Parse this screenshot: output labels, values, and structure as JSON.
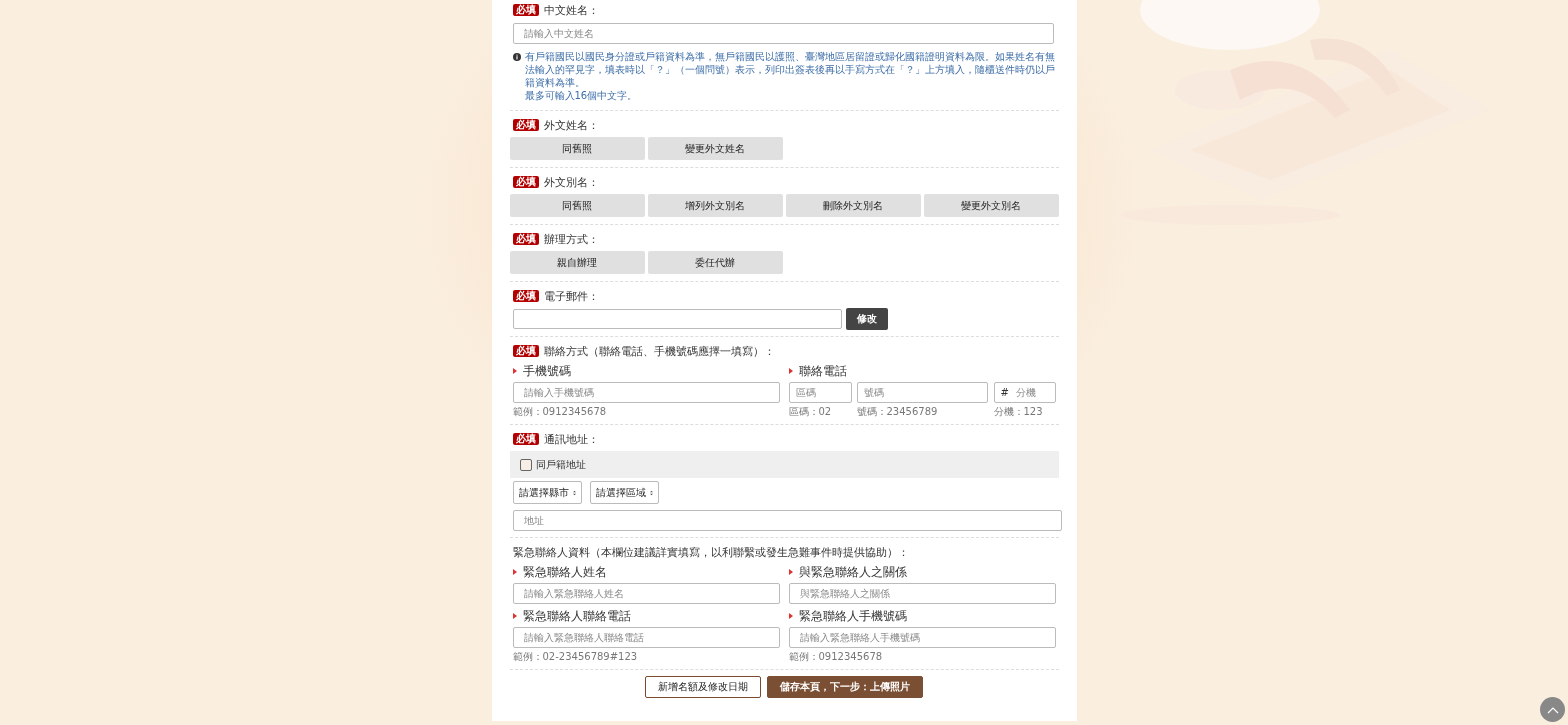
{
  "sections": [
    {
      "kind": "text",
      "badge": "必填",
      "label": "中文姓名：",
      "placeholder": "請輸入中文姓名",
      "notes": [
        "有戶籍國民以國民身分證或戶籍資料為準，無戶籍國民以護照、臺灣地區居留證或歸化國籍證明資料為限。如果姓名有無法輸入的罕見字，填表時以「？」（一個問號）表示，列印出簽表後再以手寫方式在「？」上方填入，隨櫃送件時仍以戶籍資料為準。",
        "最多可輸入16個中文字。"
      ]
    },
    {
      "kind": "buttons",
      "badge": "必填",
      "label": "外文姓名：",
      "buttons": [
        "同舊照",
        "變更外文姓名"
      ]
    },
    {
      "kind": "buttons",
      "badge": "必填",
      "label": "外文別名：",
      "buttons": [
        "同舊照",
        "增列外文別名",
        "刪除外文別名",
        "變更外文別名"
      ]
    },
    {
      "kind": "buttons",
      "badge": "必填",
      "label": "辦理方式：",
      "buttons": [
        "親自辦理",
        "委任代辦"
      ]
    },
    {
      "kind": "email",
      "badge": "必填",
      "label": "電子郵件：",
      "button": "修改"
    },
    {
      "kind": "contact",
      "badge": "必填",
      "label": "聯絡方式（聯絡電話、手機號碼應擇一填寫）：",
      "mobile": {
        "title": "手機號碼",
        "placeholder": "請輸入手機號碼",
        "hint": "範例：0912345678"
      },
      "phone": {
        "title": "聯絡電話",
        "fields": [
          {
            "placeholder": "區碼",
            "hint": "區碼：02"
          },
          {
            "placeholder": "號碼",
            "hint": "號碼：23456789"
          },
          {
            "prefix": "#",
            "placeholder": "分機",
            "hint": "分機：123"
          }
        ]
      }
    },
    {
      "kind": "address",
      "badge": "必填",
      "label": "通訊地址：",
      "checkbox": {
        "label": "同戶籍地址",
        "checked": false
      },
      "selects": [
        "請選擇縣市",
        "請選擇區域"
      ],
      "placeholder": "地址"
    },
    {
      "kind": "emergency",
      "label": "緊急聯絡人資料（本欄位建議詳實填寫，以利聯繫或發生急難事件時提供協助）：",
      "fields": [
        {
          "title": "緊急聯絡人姓名",
          "placeholder": "請輸入緊急聯絡人姓名"
        },
        {
          "title": "與緊急聯絡人之關係",
          "placeholder": "與緊急聯絡人之關係"
        },
        {
          "title": "緊急聯絡人聯絡電話",
          "placeholder": "請輸入緊急聯絡人聯絡電話",
          "hint": "範例：02-23456789#123"
        },
        {
          "title": "緊急聯絡人手機號碼",
          "placeholder": "請輸入緊急聯絡人手機號碼",
          "hint": "範例：0912345678"
        }
      ]
    }
  ],
  "actions": [
    {
      "kind": "outline",
      "label": "新增名額及修改日期"
    },
    {
      "kind": "primary",
      "label": "儲存本頁，下一步：上傳照片"
    }
  ]
}
